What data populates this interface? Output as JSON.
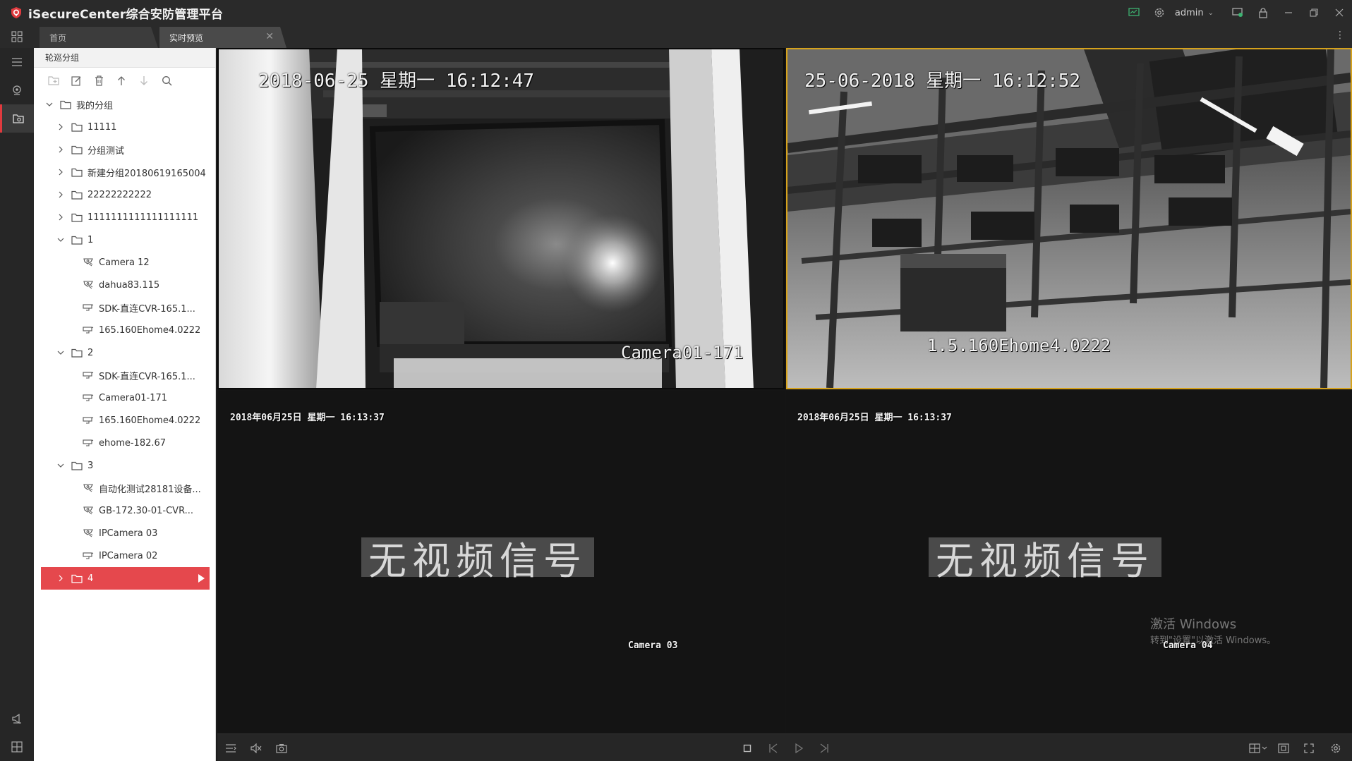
{
  "app": {
    "title": "iSecureCenter综合安防管理平台",
    "accent": "#e5484d",
    "user": "admin"
  },
  "tabs": [
    {
      "label": "首页"
    },
    {
      "label": "实时预览"
    }
  ],
  "panel": {
    "title": "轮巡分组",
    "tree": [
      {
        "level": 0,
        "type": "folder",
        "expanded": true,
        "label": "我的分组"
      },
      {
        "level": 1,
        "type": "folder",
        "expanded": false,
        "label": "11111"
      },
      {
        "level": 1,
        "type": "folder",
        "expanded": false,
        "label": "分组测试"
      },
      {
        "level": 1,
        "type": "folder",
        "expanded": false,
        "label": "新建分组20180619165004"
      },
      {
        "level": 1,
        "type": "folder",
        "expanded": false,
        "label": "22222222222"
      },
      {
        "level": 1,
        "type": "folder",
        "expanded": false,
        "label": "1111111111111111111"
      },
      {
        "level": 1,
        "type": "folder",
        "expanded": true,
        "label": "1"
      },
      {
        "level": 2,
        "type": "dome",
        "label": "Camera 12"
      },
      {
        "level": 2,
        "type": "dome",
        "label": "dahua83.115"
      },
      {
        "level": 2,
        "type": "bullet",
        "label": "SDK-直连CVR-165.1..."
      },
      {
        "level": 2,
        "type": "bullet",
        "label": "165.160Ehome4.0222"
      },
      {
        "level": 1,
        "type": "folder",
        "expanded": true,
        "label": "2"
      },
      {
        "level": 2,
        "type": "bullet",
        "label": "SDK-直连CVR-165.1..."
      },
      {
        "level": 2,
        "type": "bullet",
        "label": "Camera01-171"
      },
      {
        "level": 2,
        "type": "bullet",
        "label": "165.160Ehome4.0222"
      },
      {
        "level": 2,
        "type": "bullet",
        "label": "ehome-182.67"
      },
      {
        "level": 1,
        "type": "folder",
        "expanded": true,
        "label": "3"
      },
      {
        "level": 2,
        "type": "dome",
        "label": "自动化测试28181设备..."
      },
      {
        "level": 2,
        "type": "dome",
        "label": "GB-172.30-01-CVR..."
      },
      {
        "level": 2,
        "type": "dome",
        "label": "IPCamera 03"
      },
      {
        "level": 2,
        "type": "bullet",
        "label": "IPCamera 02"
      },
      {
        "level": 1,
        "type": "folder",
        "expanded": false,
        "selected": true,
        "label": "4"
      }
    ]
  },
  "videos": {
    "v1": {
      "timestamp": "2018-06-25 星期一 16:12:47",
      "camera": "Camera01-171"
    },
    "v2": {
      "timestamp": "25-06-2018 星期一 16:12:52",
      "camera": "1.5.160Ehome4.0222"
    },
    "v3": {
      "timestamp": "2018年06月25日 星期一 16:13:37",
      "camera": "Camera 03",
      "no_signal": "无视频信号"
    },
    "v4": {
      "timestamp": "2018年06月25日 星期一 16:13:37",
      "camera": "Camera 04",
      "no_signal": "无视频信号"
    }
  },
  "watermark": {
    "line1": "激活 Windows",
    "line2": "转到\"设置\"以激活 Windows。"
  }
}
